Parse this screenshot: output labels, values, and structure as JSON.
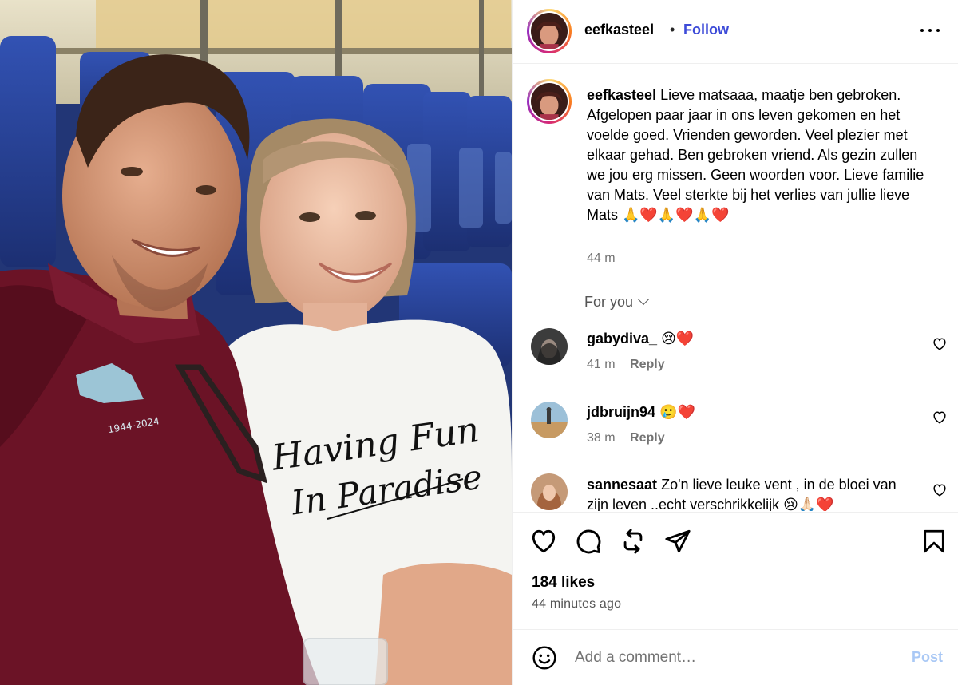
{
  "post": {
    "username": "eefkasteel",
    "dot": "•",
    "follow_label": "Follow",
    "caption": "Lieve matsaaa, maatje ben gebroken. Afgelopen paar jaar in ons leven gekomen en het voelde goed. Vrienden geworden. Veel plezier met elkaar gehad. Ben gebroken vriend. Als gezin zullen we jou erg missen. Geen woorden voor. Lieve familie van Mats. Veel sterkte bij het verlies van jullie lieve Mats 🙏❤️🙏❤️🙏❤️",
    "caption_time": "44 m",
    "likes": "184 likes",
    "posted": "44 minutes ago",
    "photo": {
      "shirt_text_line1": "Having Fun",
      "shirt_text_line2": "In Paradise",
      "badge_text": "1944-2024"
    }
  },
  "comments_section": {
    "for_you_label": "For you",
    "comments": [
      {
        "username": "gabydiva_",
        "text": "😢❤️",
        "time": "41 m",
        "reply": "Reply"
      },
      {
        "username": "jdbruijn94",
        "text": "🥲❤️",
        "time": "38 m",
        "reply": "Reply"
      },
      {
        "username": "sannesaat",
        "text": "Zo'n lieve leuke vent , in de bloei van zijn leven ..echt verschrikkelijk 😢🙏🏻❤️"
      }
    ]
  },
  "composer": {
    "placeholder": "Add a comment…",
    "post_label": "Post"
  },
  "icons": {
    "more": "more-icon",
    "like": "heart-icon",
    "comment": "comment-icon",
    "share": "repost-icon",
    "send": "send-icon",
    "save": "bookmark-icon",
    "emoji": "emoji-icon",
    "comment_like": "heart-outline-icon"
  },
  "colors": {
    "follow": "#3d4bd8",
    "post_disabled": "#a9c8f5",
    "secondary_text": "#737373"
  }
}
